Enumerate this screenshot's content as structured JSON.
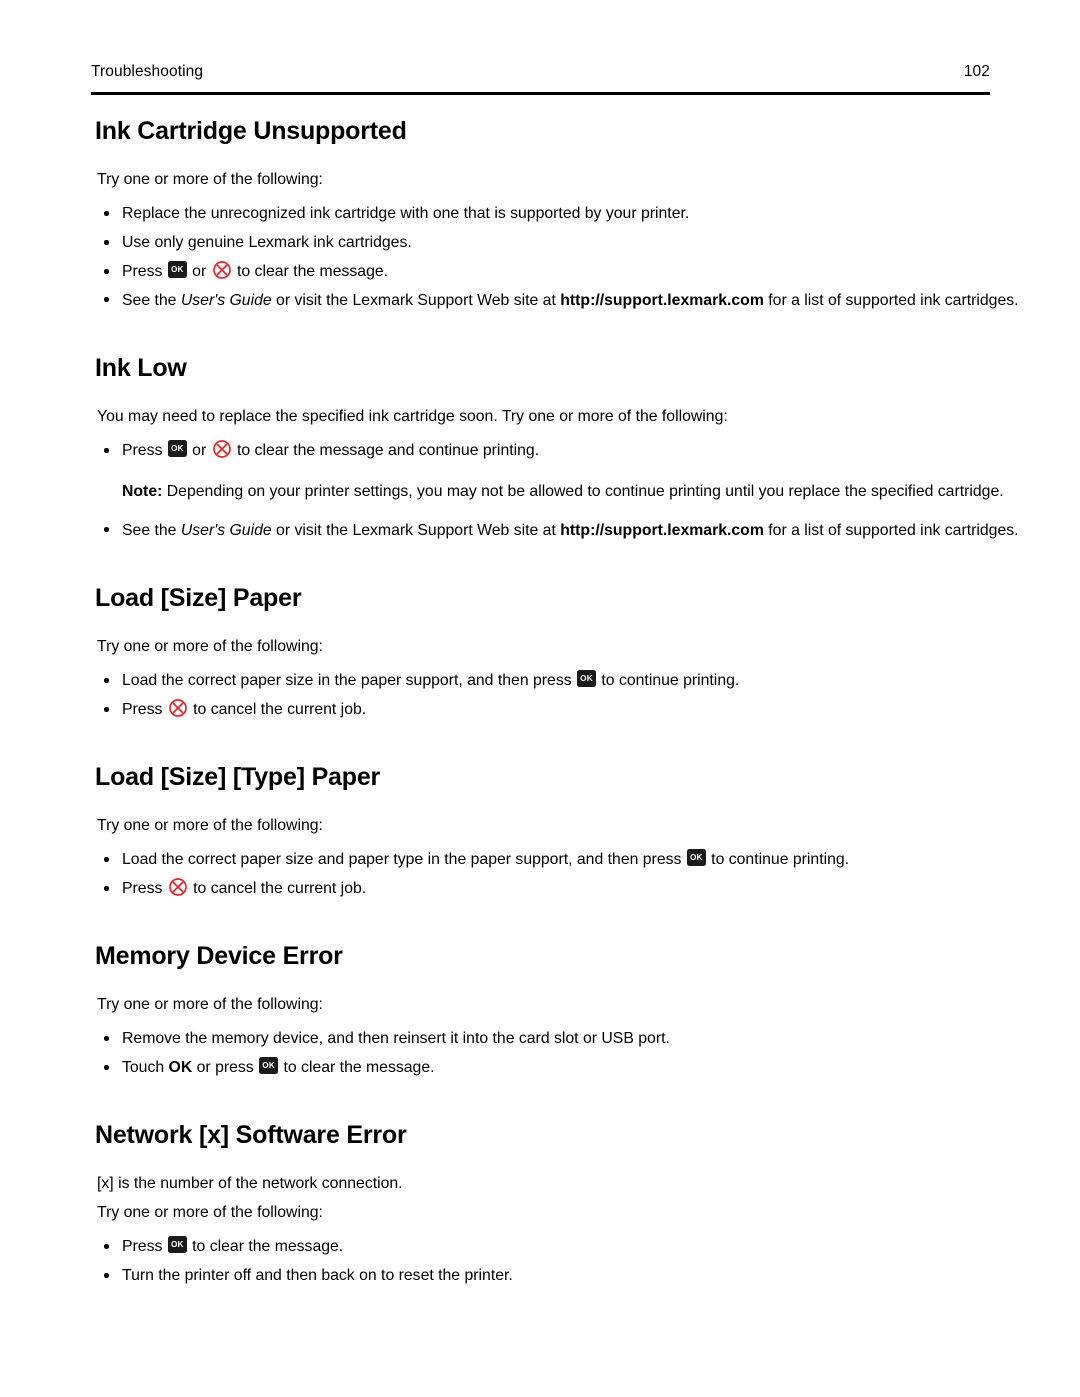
{
  "header": {
    "title": "Troubleshooting",
    "page_number": "102"
  },
  "colors": {
    "text": "#000000",
    "rule": "#000000",
    "ok_button_bg": "#1b1b1b",
    "ok_button_fg": "#ffffff",
    "cancel_icon": "#e8242a"
  },
  "icons": {
    "ok_label": "OK",
    "ok_name": "ok-button-icon",
    "cancel_name": "cancel-button-icon"
  },
  "sections": [
    {
      "id": "ink-cartridge-unsupported",
      "title": "Ink Cartridge Unsupported",
      "intro": "Try one or more of the following:",
      "bullets": [
        {
          "pre": "Replace the unrecognized ink cartridge with one that is supported by your printer."
        },
        {
          "pre": "Use only genuine Lexmark ink cartridges."
        },
        {
          "pre": "Press ",
          "icon1": "ok",
          "mid": " or ",
          "icon2": "cancel",
          "post": " to clear the message."
        },
        {
          "pre": "See the ",
          "italic": "User's Guide",
          "mid2": " or visit the Lexmark Support Web site at ",
          "bold": "http://support.lexmark.com",
          "post2": " for a list of supported ink cartridges."
        }
      ]
    },
    {
      "id": "ink-low",
      "title": "Ink Low",
      "intro": "You may need to replace the specified ink cartridge soon. Try one or more of the following:",
      "bullets": [
        {
          "pre": "Press ",
          "icon1": "ok",
          "mid": " or ",
          "icon2": "cancel",
          "post": " to clear the message and continue printing."
        }
      ],
      "note": {
        "label": "Note:",
        "text": " Depending on your printer settings, you may not be allowed to continue printing until you replace the specified cartridge."
      },
      "bullets_after_note": [
        {
          "pre": "See the ",
          "italic": "User's Guide",
          "mid2": " or visit the Lexmark Support Web site at ",
          "bold": "http://support.lexmark.com",
          "post2": " for a list of supported ink cartridges."
        }
      ]
    },
    {
      "id": "load-size-paper",
      "title": "Load [Size] Paper",
      "intro": "Try one or more of the following:",
      "bullets": [
        {
          "pre": "Load the correct paper size in the paper support, and then press ",
          "icon1": "ok",
          "post": " to continue printing."
        },
        {
          "pre": "Press ",
          "icon2": "cancel",
          "post": " to cancel the current job."
        }
      ]
    },
    {
      "id": "load-size-type-paper",
      "title": "Load [Size] [Type] Paper",
      "intro": "Try one or more of the following:",
      "bullets": [
        {
          "pre": "Load the correct paper size and paper type in the paper support, and then press ",
          "icon1": "ok",
          "post": " to continue printing."
        },
        {
          "pre": "Press ",
          "icon2": "cancel",
          "post": " to cancel the current job."
        }
      ]
    },
    {
      "id": "memory-device-error",
      "title": "Memory Device Error",
      "intro": "Try one or more of the following:",
      "bullets": [
        {
          "pre": "Remove the memory device, and then reinsert it into the card slot or USB port."
        },
        {
          "pre": "Touch ",
          "bold": "OK",
          "mid": " or press ",
          "icon1": "ok",
          "post": " to clear the message."
        }
      ]
    },
    {
      "id": "network-x-software-error",
      "title": "Network [x] Software Error",
      "intro": "[x] is the number of the network connection.",
      "intro2": "Try one or more of the following:",
      "bullets": [
        {
          "pre": "Press ",
          "icon1": "ok",
          "post": " to clear the message."
        },
        {
          "pre": "Turn the printer off and then back on to reset the printer."
        }
      ]
    }
  ]
}
